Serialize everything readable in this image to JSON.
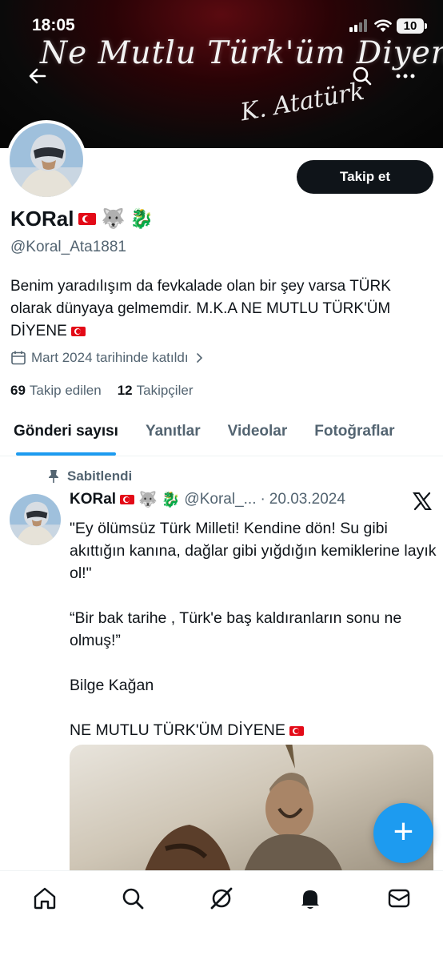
{
  "status_bar": {
    "time": "18:05",
    "battery": "10"
  },
  "banner": {
    "slogan": "Ne Mutlu Türk'üm Diyene !",
    "signature": "K. Atatürk"
  },
  "profile": {
    "follow_label": "Takip et",
    "display_name": "KORal",
    "handle": "@Koral_Ata1881",
    "bio": "Benim yaradılışım da fevkalade olan bir şey varsa TÜRK olarak dünyaya gelmemdir. M.K.A NE MUTLU TÜRK'ÜM DİYENE",
    "joined": "Mart 2024 tarihinde katıldı",
    "following_count": "69",
    "following_label": "Takip edilen",
    "followers_count": "12",
    "followers_label": "Takipçiler"
  },
  "tabs": [
    {
      "label": "Gönderi sayısı",
      "active": true
    },
    {
      "label": "Yanıtlar"
    },
    {
      "label": "Videolar"
    },
    {
      "label": "Fotoğraflar"
    }
  ],
  "post": {
    "pinned_label": "Sabitlendi",
    "name": "KORal",
    "handle": "@Koral_...",
    "separator": "·",
    "date": "20.03.2024",
    "paragraphs": [
      "\"Ey ölümsüz Türk Milleti! Kendine dön! Su gibi akıttığın kanına, dağlar gibi yığdığın kemiklerine layık ol!\"",
      "“Bir bak tarihe , Türk'e baş kaldıranların sonu ne olmuş!”",
      "Bilge Kağan",
      "NE MUTLU TÜRK'ÜM DİYENE"
    ]
  },
  "fab_label": "+",
  "colors": {
    "accent": "#1d9bf0",
    "text": "#0f1419",
    "muted": "#536471"
  }
}
